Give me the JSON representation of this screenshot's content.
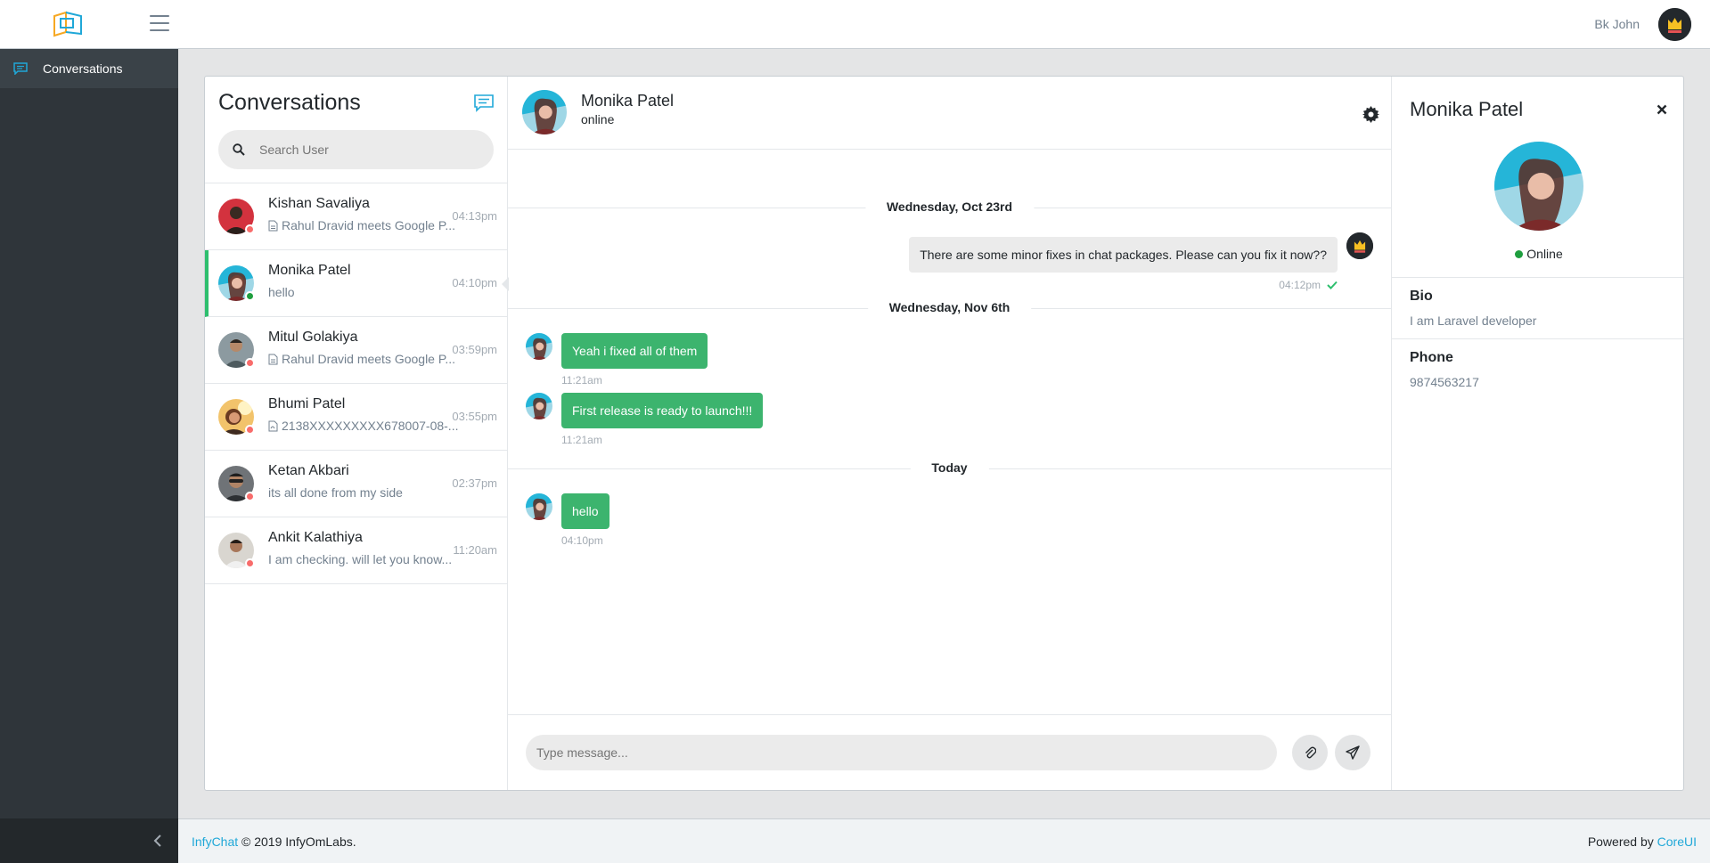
{
  "header": {
    "user_name": "Bk John",
    "icons": {
      "logo": "infychat-logo-icon",
      "menu": "hamburger-icon",
      "user": "crown-avatar-icon"
    }
  },
  "sidebar": {
    "items": [
      {
        "label": "Conversations",
        "icon": "chat-bubble-icon"
      }
    ],
    "minimizer_icon": "chevron-left-icon"
  },
  "conversations": {
    "title": "Conversations",
    "search_placeholder": "Search User",
    "items": [
      {
        "name": "Kishan Savaliya",
        "message": "Rahul Dravid meets Google P...",
        "time": "04:13pm",
        "status": "offline",
        "has_file_icon": true,
        "active": false
      },
      {
        "name": "Monika Patel",
        "message": "hello",
        "time": "04:10pm",
        "status": "online",
        "has_file_icon": false,
        "active": true
      },
      {
        "name": "Mitul Golakiya",
        "message": "Rahul Dravid meets Google P...",
        "time": "03:59pm",
        "status": "offline",
        "has_file_icon": true,
        "active": false
      },
      {
        "name": "Bhumi Patel",
        "message": "2138XXXXXXXXX678007-08-...",
        "time": "03:55pm",
        "status": "offline",
        "has_file_icon": true,
        "active": false
      },
      {
        "name": "Ketan Akbari",
        "message": "its all done from my side",
        "time": "02:37pm",
        "status": "offline",
        "has_file_icon": false,
        "active": false
      },
      {
        "name": "Ankit Kalathiya",
        "message": "I am checking. will let you know...",
        "time": "11:20am",
        "status": "offline",
        "has_file_icon": false,
        "active": false
      }
    ]
  },
  "chat": {
    "contact_name": "Monika Patel",
    "contact_status": "online",
    "date_separators": [
      "Wednesday, Oct 23rd",
      "Wednesday, Nov 6th",
      "Today"
    ],
    "messages": [
      {
        "direction": "out",
        "text": "There are some minor fixes in chat packages. Please can you fix it now??",
        "time": "04:12pm",
        "read": true
      },
      {
        "direction": "in",
        "text": "Yeah i fixed all of them",
        "time": "11:21am"
      },
      {
        "direction": "in",
        "text": "First release is ready to launch!!!",
        "time": "11:21am"
      },
      {
        "direction": "in",
        "text": "hello",
        "time": "04:10pm"
      }
    ],
    "composer_placeholder": "Type message..."
  },
  "profile": {
    "name": "Monika Patel",
    "status": "Online",
    "bio_label": "Bio",
    "bio": "I am Laravel developer",
    "phone_label": "Phone",
    "phone": "9874563217"
  },
  "footer": {
    "brand": "InfyChat",
    "copyright": "© 2019 InfyOmLabs.",
    "powered_by": "Powered by",
    "powered_link": "CoreUI"
  },
  "colors": {
    "accent_green": "#3cb46e",
    "active_border": "#2ebf6e",
    "online": "#1e9e3e",
    "offline": "#f86c6b",
    "link": "#20a8d8"
  }
}
